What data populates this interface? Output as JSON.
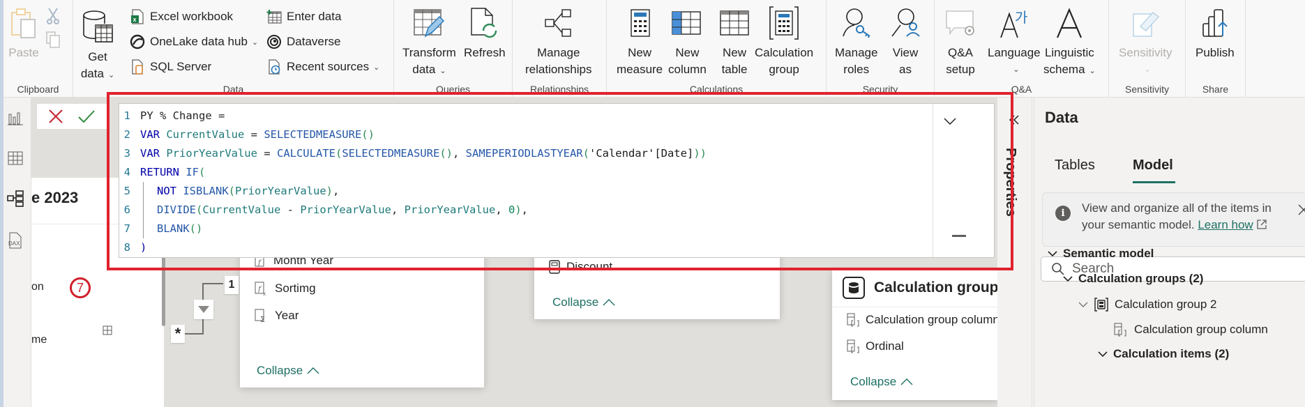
{
  "ribbon": {
    "groups": {
      "clipboard": "Clipboard",
      "data": "Data",
      "queries": "Queries",
      "relationships": "Relationships",
      "calculations": "Calculations",
      "security": "Security",
      "qa": "Q&A",
      "sensitivity": "Sensitivity",
      "share": "Share"
    },
    "paste": "Paste",
    "get_data_1": "Get",
    "get_data_2": "data",
    "excel_workbook": "Excel workbook",
    "onelake_data_hub": "OneLake data hub",
    "sql_server": "SQL Server",
    "enter_data": "Enter data",
    "dataverse": "Dataverse",
    "recent_sources": "Recent sources",
    "transform_data_1": "Transform",
    "transform_data_2": "data",
    "refresh": "Refresh",
    "manage_relationships_1": "Manage",
    "manage_relationships_2": "relationships",
    "new_measure_1": "New",
    "new_measure_2": "measure",
    "new_column_1": "New",
    "new_column_2": "column",
    "new_table_1": "New",
    "new_table_2": "table",
    "calculation_group_1": "Calculation",
    "calculation_group_2": "group",
    "manage_roles_1": "Manage",
    "manage_roles_2": "roles",
    "view_as_1": "View",
    "view_as_2": "as",
    "qa_setup_1": "Q&A",
    "qa_setup_2": "setup",
    "language": "Language",
    "linguistic_schema_1": "Linguistic",
    "linguistic_schema_2": "schema",
    "sensitivity": "Sensitivity",
    "publish": "Publish"
  },
  "editor": {
    "lines": [
      {
        "n": "1",
        "tokens": [
          {
            "t": "PY % Change =",
            "c": "txt"
          }
        ]
      },
      {
        "n": "2",
        "tokens": [
          {
            "t": "VAR ",
            "c": "kw"
          },
          {
            "t": "CurrentValue",
            "c": "var"
          },
          {
            "t": " = ",
            "c": "txt"
          },
          {
            "t": "SELECTEDMEASURE",
            "c": "fn"
          },
          {
            "t": "()",
            "c": "par"
          }
        ]
      },
      {
        "n": "3",
        "tokens": [
          {
            "t": "VAR ",
            "c": "kw"
          },
          {
            "t": "PriorYearValue",
            "c": "var"
          },
          {
            "t": " = ",
            "c": "txt"
          },
          {
            "t": "CALCULATE",
            "c": "fn"
          },
          {
            "t": "(",
            "c": "par"
          },
          {
            "t": "SELECTEDMEASURE",
            "c": "fn"
          },
          {
            "t": "()",
            "c": "par"
          },
          {
            "t": ", ",
            "c": "txt"
          },
          {
            "t": "SAMEPERIODLASTYEAR",
            "c": "fn"
          },
          {
            "t": "(",
            "c": "par"
          },
          {
            "t": "'Calendar'",
            "c": "str"
          },
          {
            "t": "[Date]",
            "c": "col"
          },
          {
            "t": "))",
            "c": "par"
          }
        ]
      },
      {
        "n": "4",
        "tokens": [
          {
            "t": "RETURN ",
            "c": "kw"
          },
          {
            "t": "IF",
            "c": "fn"
          },
          {
            "t": "(",
            "c": "par"
          }
        ]
      },
      {
        "n": "5",
        "indent": true,
        "tokens": [
          {
            "t": "NOT ",
            "c": "kw"
          },
          {
            "t": "ISBLANK",
            "c": "fn"
          },
          {
            "t": "(",
            "c": "par"
          },
          {
            "t": "PriorYearValue",
            "c": "var"
          },
          {
            "t": ")",
            "c": "par"
          },
          {
            "t": ",",
            "c": "txt"
          }
        ]
      },
      {
        "n": "6",
        "indent": true,
        "tokens": [
          {
            "t": "DIVIDE",
            "c": "fn"
          },
          {
            "t": "(",
            "c": "par"
          },
          {
            "t": "CurrentValue",
            "c": "var"
          },
          {
            "t": " - ",
            "c": "txt"
          },
          {
            "t": "PriorYearValue",
            "c": "var"
          },
          {
            "t": ", ",
            "c": "txt"
          },
          {
            "t": "PriorYearValue",
            "c": "var"
          },
          {
            "t": ", ",
            "c": "txt"
          },
          {
            "t": "0",
            "c": "num"
          },
          {
            "t": ")",
            "c": "par"
          },
          {
            "t": ",",
            "c": "txt"
          }
        ]
      },
      {
        "n": "7",
        "indent": true,
        "tokens": [
          {
            "t": "BLANK",
            "c": "fn"
          },
          {
            "t": "()",
            "c": "par"
          }
        ]
      },
      {
        "n": "8",
        "tokens": [
          {
            "t": ")",
            "c": "kw"
          }
        ]
      }
    ]
  },
  "canvas": {
    "page_title": "e 2023",
    "row_on": "on",
    "row_me": "me",
    "badge_number": "7",
    "rel_one": "1",
    "rel_many": "*",
    "calendar_card": {
      "fields": [
        "Month Year",
        "Sortimg",
        "Year"
      ],
      "collapse": "Collapse"
    },
    "sales_card": {
      "fields": [
        "Discount"
      ],
      "collapse": "Collapse"
    },
    "calc_group_card": {
      "title": "Calculation group",
      "fields": [
        "Calculation group column",
        "Ordinal"
      ],
      "collapse": "Collapse"
    }
  },
  "properties": {
    "label": "Properties"
  },
  "data_pane": {
    "title": "Data",
    "tabs": [
      "Tables",
      "Model"
    ],
    "active_tab": "Model",
    "info": {
      "text": "View and organize all of the items in your semantic model.",
      "link": "Learn how"
    },
    "search_placeholder": "Search",
    "tree": [
      {
        "label": "Semantic model",
        "level": 0,
        "bold": true,
        "expanded": true
      },
      {
        "label": "Calculation groups (2)",
        "level": 1,
        "bold": true,
        "expanded": true
      },
      {
        "label": "Calculation group 2",
        "level": 2,
        "bold": false,
        "expanded": true
      },
      {
        "label": "Calculation group column",
        "level": 3,
        "bold": false
      },
      {
        "label": "Calculation items (2)",
        "level": 3,
        "bold": true,
        "expanded": true
      }
    ]
  },
  "colors": {
    "accent": "#1d6f63",
    "highlight": "#e0232e",
    "cancel": "#c4262e",
    "commit": "#2e8b3e"
  }
}
